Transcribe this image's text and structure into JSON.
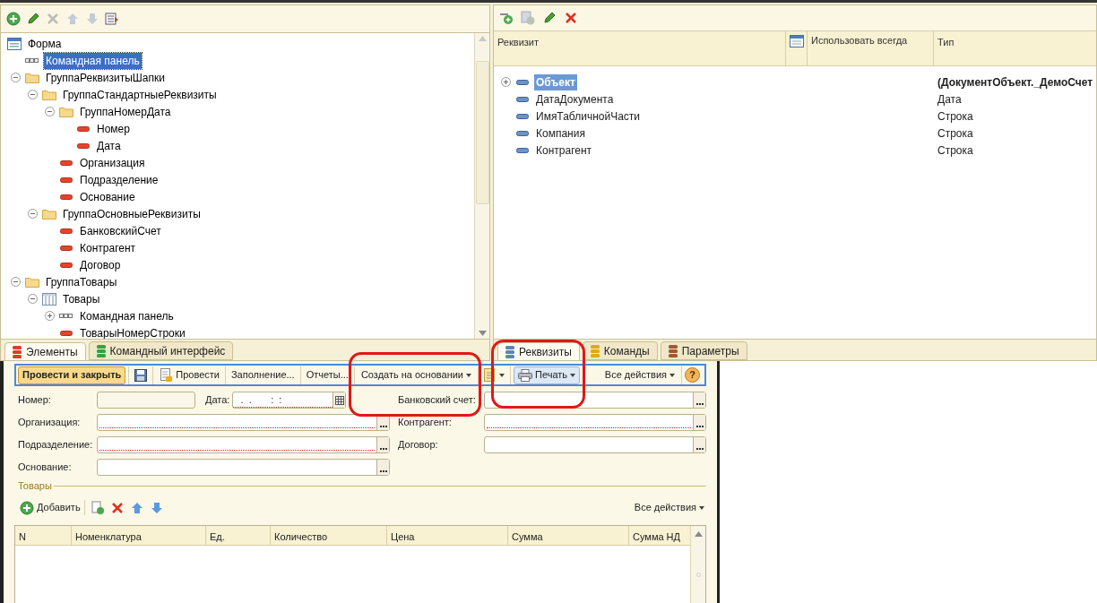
{
  "elements_panel": {
    "tree": [
      {
        "label": "Форма",
        "kind": "form",
        "selected": false,
        "children": [
          {
            "label": "Командная панель",
            "kind": "panel",
            "selected": true
          },
          {
            "label": "ГруппаРеквизитыШапки",
            "kind": "folder",
            "selected": false,
            "expanded": true,
            "children": [
              {
                "label": "ГруппаСтандартныеРеквизиты",
                "kind": "folder",
                "selected": false,
                "expanded": true,
                "children": [
                  {
                    "label": "ГруппаНомерДата",
                    "kind": "folder",
                    "selected": false,
                    "expanded": true,
                    "children": [
                      {
                        "label": "Номер",
                        "kind": "field",
                        "selected": false
                      },
                      {
                        "label": "Дата",
                        "kind": "field",
                        "selected": false
                      }
                    ]
                  },
                  {
                    "label": "Организация",
                    "kind": "field",
                    "selected": false
                  },
                  {
                    "label": "Подразделение",
                    "kind": "field",
                    "selected": false
                  },
                  {
                    "label": "Основание",
                    "kind": "field",
                    "selected": false
                  }
                ]
              },
              {
                "label": "ГруппаОсновныеРеквизиты",
                "kind": "folder",
                "selected": false,
                "expanded": true,
                "children": [
                  {
                    "label": "БанковскийСчет",
                    "kind": "field",
                    "selected": false
                  },
                  {
                    "label": "Контрагент",
                    "kind": "field",
                    "selected": false
                  },
                  {
                    "label": "Договор",
                    "kind": "field",
                    "selected": false
                  }
                ]
              }
            ]
          },
          {
            "label": "ГруппаТовары",
            "kind": "folder",
            "selected": false,
            "expanded": true,
            "children": [
              {
                "label": "Товары",
                "kind": "table",
                "selected": false,
                "expanded": true,
                "children": [
                  {
                    "label": "Командная панель",
                    "kind": "panel",
                    "selected": false,
                    "expanded": false
                  },
                  {
                    "label": "ТоварыНомерСтроки",
                    "kind": "field",
                    "selected": false
                  }
                ]
              }
            ]
          }
        ]
      }
    ],
    "tabs": [
      {
        "label": "Элементы",
        "selected": true,
        "color": "#d9402a"
      },
      {
        "label": "Командный интерфейс",
        "selected": false,
        "color": "#3aa040"
      }
    ]
  },
  "attributes_panel": {
    "columns": [
      "Реквизит",
      "Использовать всегда",
      "Тип"
    ],
    "rows": [
      {
        "name": "Объект",
        "type": "(ДокументОбъект._ДемоСчет",
        "selected": true,
        "expanded": false
      },
      {
        "name": "ДатаДокумента",
        "type": "Дата",
        "selected": false
      },
      {
        "name": "ИмяТабличнойЧасти",
        "type": "Строка",
        "selected": false
      },
      {
        "name": "Компания",
        "type": "Строка",
        "selected": false
      },
      {
        "name": "Контрагент",
        "type": "Строка",
        "selected": false
      }
    ],
    "tabs": [
      {
        "label": "Реквизиты",
        "selected": true,
        "color": "#5b86b8",
        "highlighted": true
      },
      {
        "label": "Команды",
        "selected": false,
        "color": "#e0a820",
        "highlighted": false
      },
      {
        "label": "Параметры",
        "selected": false,
        "color": "#a05a30",
        "highlighted": false
      }
    ]
  },
  "form_preview": {
    "command_bar": [
      {
        "kind": "default",
        "label": "Провести и закрыть",
        "highlighted": false
      },
      {
        "kind": "save",
        "highlighted": false
      },
      {
        "kind": "post",
        "label": "Провести",
        "highlighted": false
      },
      {
        "kind": "button",
        "label": "Заполнение...",
        "highlighted": false
      },
      {
        "kind": "button",
        "label": "Отчеты...",
        "highlighted": false
      },
      {
        "kind": "menu",
        "label": "Создать на основании",
        "highlighted": true
      },
      {
        "kind": "doc-menu",
        "highlighted": false
      },
      {
        "kind": "print-menu",
        "label": "Печать",
        "selected": true,
        "highlighted": false
      },
      {
        "kind": "spacer"
      },
      {
        "kind": "menu",
        "label": "Все действия",
        "highlighted": false
      },
      {
        "kind": "help",
        "label": "?",
        "highlighted": false
      }
    ],
    "left_fields": [
      {
        "label": "Номер:",
        "kind": "number"
      },
      {
        "label": "Организация:",
        "kind": "select",
        "required": true
      },
      {
        "label": "Подразделение:",
        "kind": "select",
        "required": true
      },
      {
        "label": "Основание:",
        "kind": "select",
        "required": false
      }
    ],
    "date_field": {
      "label": "Дата:",
      "value": "  .  .       :  :  ",
      "required": true
    },
    "right_fields": [
      {
        "label": "Банковский счет:",
        "required": false
      },
      {
        "label": "Контрагент:",
        "required": true
      },
      {
        "label": "Договор:",
        "required": false
      }
    ],
    "goods": {
      "title": "Товары",
      "add_button": "Добавить",
      "all_actions": "Все действия",
      "columns": [
        "N",
        "Номенклатура",
        "Ед.",
        "Количество",
        "Цена",
        "Сумма",
        "Сумма НД"
      ]
    }
  }
}
